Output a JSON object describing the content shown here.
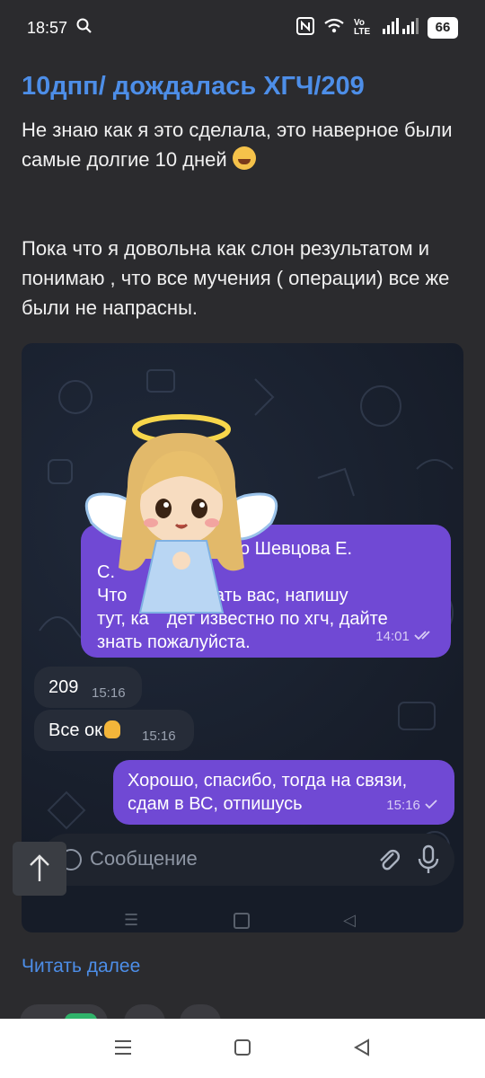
{
  "status_bar": {
    "time": "18:57",
    "network": "Vo LTE",
    "battery": "66"
  },
  "post": {
    "title": "10дпп/ дождалась ХГЧ/209",
    "paragraph1": "Не знаю как я это сделала, это наверное были самые долгие 10 дней",
    "paragraph2": "Пока что я довольна как слон результатом и понимаю , что все мучения ( операции) все же были не напрасны.",
    "read_more": "Читать далее"
  },
  "chat": {
    "messages": [
      {
        "text": "… то Шевцова Е. С. Что … лекать вас, напишу тут, ка… дет известно по хгч, дайте знать пожалуйста.",
        "line1": "то  Шевцова Е.",
        "line2": "С.",
        "line3": "Что ",
        "line3b": "лекать вас, напишу",
        "line4": "тут, ка",
        "line4b": "дет известно по хгч, дайте",
        "line5": "знать пожалуйста.",
        "time": "14:01",
        "direction": "outgoing"
      },
      {
        "text": "209",
        "time": "15:16",
        "direction": "incoming"
      },
      {
        "text": "Все ок",
        "time": "15:16",
        "direction": "incoming"
      },
      {
        "line1": "Хорошо, спасибо, тогда на связи,",
        "line2": "сдам в ВС, отпишусь",
        "time": "15:16",
        "direction": "outgoing"
      }
    ],
    "composer_placeholder": "Сообщение"
  },
  "colors": {
    "accent": "#4d8ee8",
    "outgoing_bubble": "#7049d4",
    "background": "#2b2b2e"
  },
  "icons": [
    "search-icon",
    "nfc-icon",
    "wifi-icon",
    "signal-icon",
    "battery-icon",
    "laughing-emoji",
    "ok-hand-emoji",
    "angel-sticker",
    "double-check-icon",
    "check-icon",
    "paperclip-icon",
    "mic-icon",
    "emoji-icon",
    "arrow-up-icon",
    "menu-icon",
    "home-icon",
    "back-icon"
  ]
}
